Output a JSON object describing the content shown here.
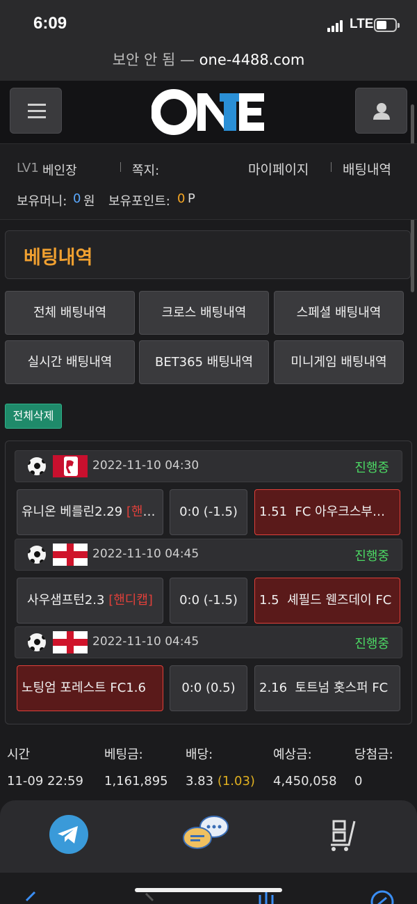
{
  "status_bar": {
    "time": "6:09",
    "network": "LTE"
  },
  "url_bar": {
    "prefix": "보안 안 됨 — ",
    "host": "one-4488.com"
  },
  "header": {
    "logo_text": "ONE",
    "menu_icon": "hamburger-icon",
    "user_icon": "user-icon"
  },
  "user_info": {
    "level": "LV1",
    "nickname": "베인장",
    "message_label": "쪽지:",
    "mypage": "마이페이지",
    "bet_history": "배팅내역",
    "money_label": "보유머니:",
    "money_value": "0",
    "money_unit": "원",
    "point_label": "보유포인트:",
    "point_value": "0",
    "point_unit": "P"
  },
  "section_title": "베팅내역",
  "tabs": [
    {
      "label": "전체 배팅내역"
    },
    {
      "label": "크로스 배팅내역"
    },
    {
      "label": "스페셜 배팅내역"
    },
    {
      "label": "실시간 배팅내역"
    },
    {
      "label": "BET365 배팅내역"
    },
    {
      "label": "미니게임 배팅내역"
    }
  ],
  "delete_all_label": "전체삭제",
  "matches": [
    {
      "league_flag": "bundesliga",
      "datetime": "2022-11-10 04:30",
      "status": "진행중",
      "home": "유니온 베를린",
      "home_odds": "2.29",
      "home_tag": "[핸디캡]",
      "score": "0:0 (-1.5)",
      "away_odds": "1.51",
      "away": "FC 아우크스부르크",
      "selected": "away"
    },
    {
      "league_flag": "england",
      "datetime": "2022-11-10 04:45",
      "status": "진행중",
      "home": "사우샘프턴",
      "home_odds": "2.3",
      "home_tag": "[핸디캡]",
      "score": "0:0 (-1.5)",
      "away_odds": "1.5",
      "away": "셰필드 웬즈데이 FC",
      "selected": "away"
    },
    {
      "league_flag": "england",
      "datetime": "2022-11-10 04:45",
      "status": "진행중",
      "home": "노팅엄 포레스트 FC",
      "home_odds": "1.6",
      "home_tag": "",
      "score": "0:0 (0.5)",
      "away_odds": "2.16",
      "away": "토트넘 홋스퍼 FC",
      "selected": "home"
    }
  ],
  "summary": {
    "labels": {
      "time": "시간",
      "amount": "베팅금:",
      "odds": "배당:",
      "expected": "예상금:",
      "win": "당첨금:"
    },
    "values": {
      "time": "11-09 22:59",
      "amount": "1,161,895",
      "odds": "3.83",
      "odds_extra": "(1.03)",
      "expected": "4,450,058",
      "win": "0"
    }
  },
  "bottom_bar": {
    "icons": [
      "telegram-icon",
      "chat-icon",
      "cart-icon"
    ]
  },
  "colors": {
    "accent": "#f0a030",
    "status_green": "#4cd964",
    "selected_red": "#e0403a",
    "money_blue": "#5aa9ff",
    "delete_green": "#1f8a6a"
  }
}
